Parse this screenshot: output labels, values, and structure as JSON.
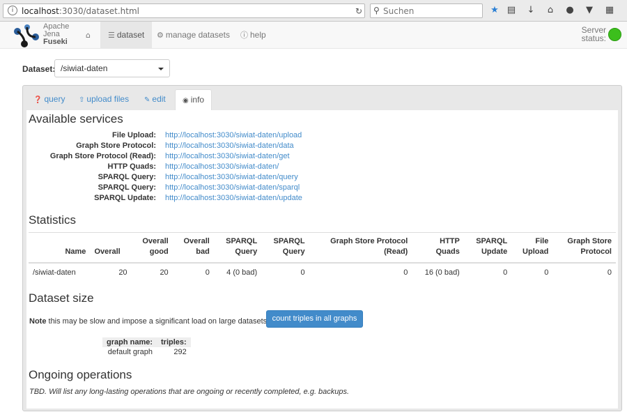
{
  "browser": {
    "url_host": "localhost",
    "url_rest": ":3030/dataset.html",
    "search_placeholder": "Suchen"
  },
  "navbar": {
    "logo_line1": "Apache",
    "logo_line2": "Jena",
    "logo_line3": "Fuseki",
    "items": [
      {
        "label": "dataset",
        "icon": "database-icon"
      },
      {
        "label": "manage datasets",
        "icon": "cogs-icon"
      },
      {
        "label": "help",
        "icon": "info-icon"
      }
    ],
    "server_status_line1": "Server",
    "server_status_line2": "status:",
    "status_color": "#3cbf1c"
  },
  "dataset": {
    "label": "Dataset:",
    "selected": "/siwiat-daten"
  },
  "tabs": [
    {
      "label": "query",
      "icon": "question-circle-icon"
    },
    {
      "label": "upload files",
      "icon": "upload-icon"
    },
    {
      "label": "edit",
      "icon": "edit-icon"
    },
    {
      "label": "info",
      "icon": "dashboard-icon"
    }
  ],
  "services": {
    "heading": "Available services",
    "items": [
      {
        "key": "File Upload:",
        "url": "http://localhost:3030/siwiat-daten/upload"
      },
      {
        "key": "Graph Store Protocol:",
        "url": "http://localhost:3030/siwiat-daten/data"
      },
      {
        "key": "Graph Store Protocol (Read):",
        "url": "http://localhost:3030/siwiat-daten/get"
      },
      {
        "key": "HTTP Quads:",
        "url": "http://localhost:3030/siwiat-daten/"
      },
      {
        "key": "SPARQL Query:",
        "url": "http://localhost:3030/siwiat-daten/query"
      },
      {
        "key": "SPARQL Query:",
        "url": "http://localhost:3030/siwiat-daten/sparql"
      },
      {
        "key": "SPARQL Update:",
        "url": "http://localhost:3030/siwiat-daten/update"
      }
    ]
  },
  "statistics": {
    "heading": "Statistics",
    "headers": [
      [
        "Name",
        ""
      ],
      [
        "Overall",
        ""
      ],
      [
        "Overall",
        "good"
      ],
      [
        "Overall",
        "bad"
      ],
      [
        "SPARQL",
        "Query"
      ],
      [
        "SPARQL",
        "Query"
      ],
      [
        "Graph Store Protocol",
        "(Read)"
      ],
      [
        "HTTP",
        "Quads"
      ],
      [
        "SPARQL",
        "Update"
      ],
      [
        "File",
        "Upload"
      ],
      [
        "Graph Store",
        "Protocol"
      ]
    ],
    "row": [
      "/siwiat-daten",
      "20",
      "20",
      "0",
      "4 (0 bad)",
      "0",
      "0",
      "16 (0 bad)",
      "0",
      "0",
      "0"
    ]
  },
  "dataset_size": {
    "heading": "Dataset size",
    "note_bold": "Note",
    "note_text": " this may be slow and impose a significant load on large datasets:",
    "button_label": "count triples in all graphs",
    "col_graph": "graph name:",
    "col_triples": "triples:",
    "graph_name": "default graph",
    "triples": "292"
  },
  "ongoing": {
    "heading": "Ongoing operations",
    "text": "TBD. Will list any long-lasting operations that are ongoing or recently completed, e.g. backups."
  }
}
